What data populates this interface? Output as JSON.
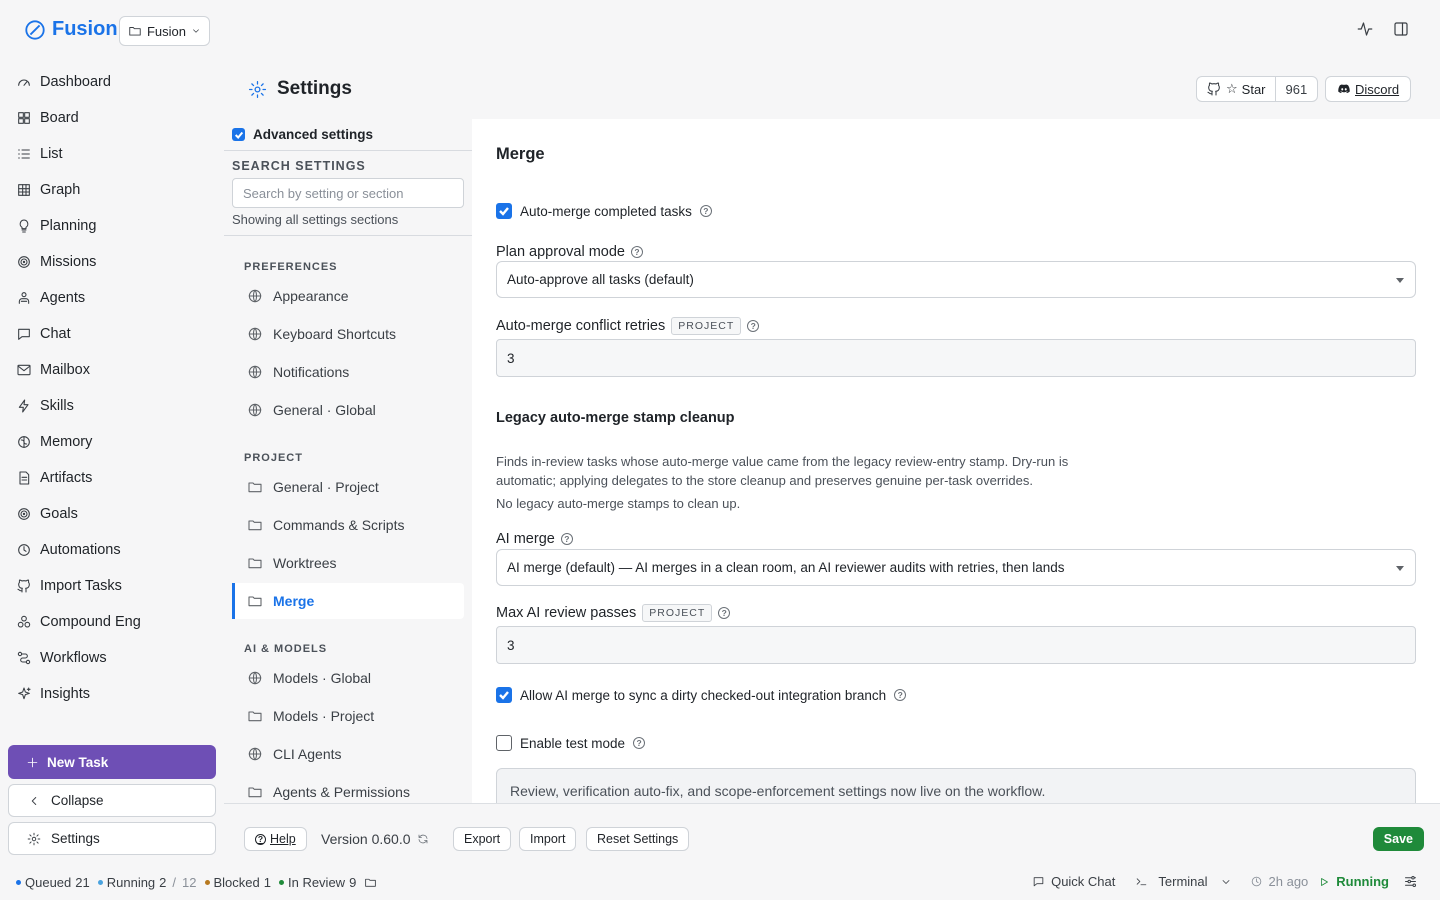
{
  "app": {
    "name": "Fusion",
    "project": "Fusion"
  },
  "nav": [
    {
      "label": "Dashboard",
      "icon": "gauge-icon"
    },
    {
      "label": "Board",
      "icon": "board-icon"
    },
    {
      "label": "List",
      "icon": "list-icon"
    },
    {
      "label": "Graph",
      "icon": "graph-icon"
    },
    {
      "label": "Planning",
      "icon": "lightbulb-icon"
    },
    {
      "label": "Missions",
      "icon": "target-icon"
    },
    {
      "label": "Agents",
      "icon": "agents-icon"
    },
    {
      "label": "Chat",
      "icon": "chat-icon"
    },
    {
      "label": "Mailbox",
      "icon": "mail-icon"
    },
    {
      "label": "Skills",
      "icon": "zap-icon"
    },
    {
      "label": "Memory",
      "icon": "brain-icon"
    },
    {
      "label": "Artifacts",
      "icon": "file-icon"
    },
    {
      "label": "Goals",
      "icon": "goal-icon"
    },
    {
      "label": "Automations",
      "icon": "clock-icon"
    },
    {
      "label": "Import Tasks",
      "icon": "github-icon"
    },
    {
      "label": "Compound Eng",
      "icon": "compound-icon"
    },
    {
      "label": "Workflows",
      "icon": "workflow-icon"
    },
    {
      "label": "Insights",
      "icon": "sparkle-icon"
    }
  ],
  "sidebar_actions": {
    "new_task": "New Task",
    "collapse": "Collapse",
    "settings": "Settings"
  },
  "header": {
    "title": "Settings",
    "github_star": "Star",
    "github_count": "961",
    "discord": "Discord"
  },
  "settings_nav": {
    "advanced_label": "Advanced settings",
    "search_heading": "SEARCH SETTINGS",
    "search_placeholder": "Search by setting or section",
    "search_note": "Showing all settings sections",
    "sections": [
      {
        "label": "PREFERENCES",
        "items": [
          {
            "label": "Appearance",
            "icon": "globe-icon"
          },
          {
            "label": "Keyboard Shortcuts",
            "icon": "globe-icon"
          },
          {
            "label": "Notifications",
            "icon": "globe-icon"
          },
          {
            "label": "General · Global",
            "icon": "globe-icon"
          }
        ]
      },
      {
        "label": "PROJECT",
        "items": [
          {
            "label": "General · Project",
            "icon": "folder-icon"
          },
          {
            "label": "Commands & Scripts",
            "icon": "folder-icon"
          },
          {
            "label": "Worktrees",
            "icon": "folder-icon"
          },
          {
            "label": "Merge",
            "icon": "folder-icon",
            "active": true
          }
        ]
      },
      {
        "label": "AI & MODELS",
        "items": [
          {
            "label": "Models · Global",
            "icon": "globe-icon"
          },
          {
            "label": "Models · Project",
            "icon": "folder-icon"
          },
          {
            "label": "CLI Agents",
            "icon": "globe-icon"
          },
          {
            "label": "Agents & Permissions",
            "icon": "folder-icon"
          }
        ]
      }
    ]
  },
  "merge": {
    "title": "Merge",
    "auto_merge_label": "Auto-merge completed tasks",
    "plan_approval_label": "Plan approval mode",
    "plan_approval_value": "Auto-approve all tasks (default)",
    "conflict_retries_label": "Auto-merge conflict retries",
    "project_tag": "PROJECT",
    "conflict_retries_value": "3",
    "legacy_title": "Legacy auto-merge stamp cleanup",
    "legacy_desc": "Finds in-review tasks whose auto-merge value came from the legacy review-entry stamp. Dry-run is automatic; applying delegates to the store cleanup and preserves genuine per-task overrides.",
    "legacy_note": "No legacy auto-merge stamps to clean up.",
    "ai_merge_label": "AI merge",
    "ai_merge_value": "AI merge (default) — AI merges in a clean room, an AI reviewer audits with retries, then lands",
    "max_review_label": "Max AI review passes",
    "max_review_value": "3",
    "allow_sync_label": "Allow AI merge to sync a dirty checked-out integration branch",
    "test_mode_label": "Enable test mode",
    "info": "Review, verification auto-fix, and scope-enforcement settings now live on the workflow."
  },
  "actions": {
    "help": "Help",
    "version": "Version 0.60.0",
    "export": "Export",
    "import": "Import",
    "reset": "Reset Settings",
    "save": "Save"
  },
  "status": {
    "queued_label": "Queued",
    "queued": "21",
    "running_label": "Running",
    "running": "2",
    "running_sep": "/",
    "running_total": "12",
    "blocked_label": "Blocked",
    "blocked": "1",
    "review_label": "In Review",
    "review": "9",
    "quick_chat": "Quick Chat",
    "terminal": "Terminal",
    "ago": "2h ago",
    "state": "Running"
  },
  "colors": {
    "accent": "#1a73e8",
    "new_task": "#6e4fb5",
    "save": "#1f8a3a",
    "queued": "#1a73e8",
    "running": "#4aa3df",
    "blocked": "#b7791f",
    "review": "#1f8a3a"
  }
}
